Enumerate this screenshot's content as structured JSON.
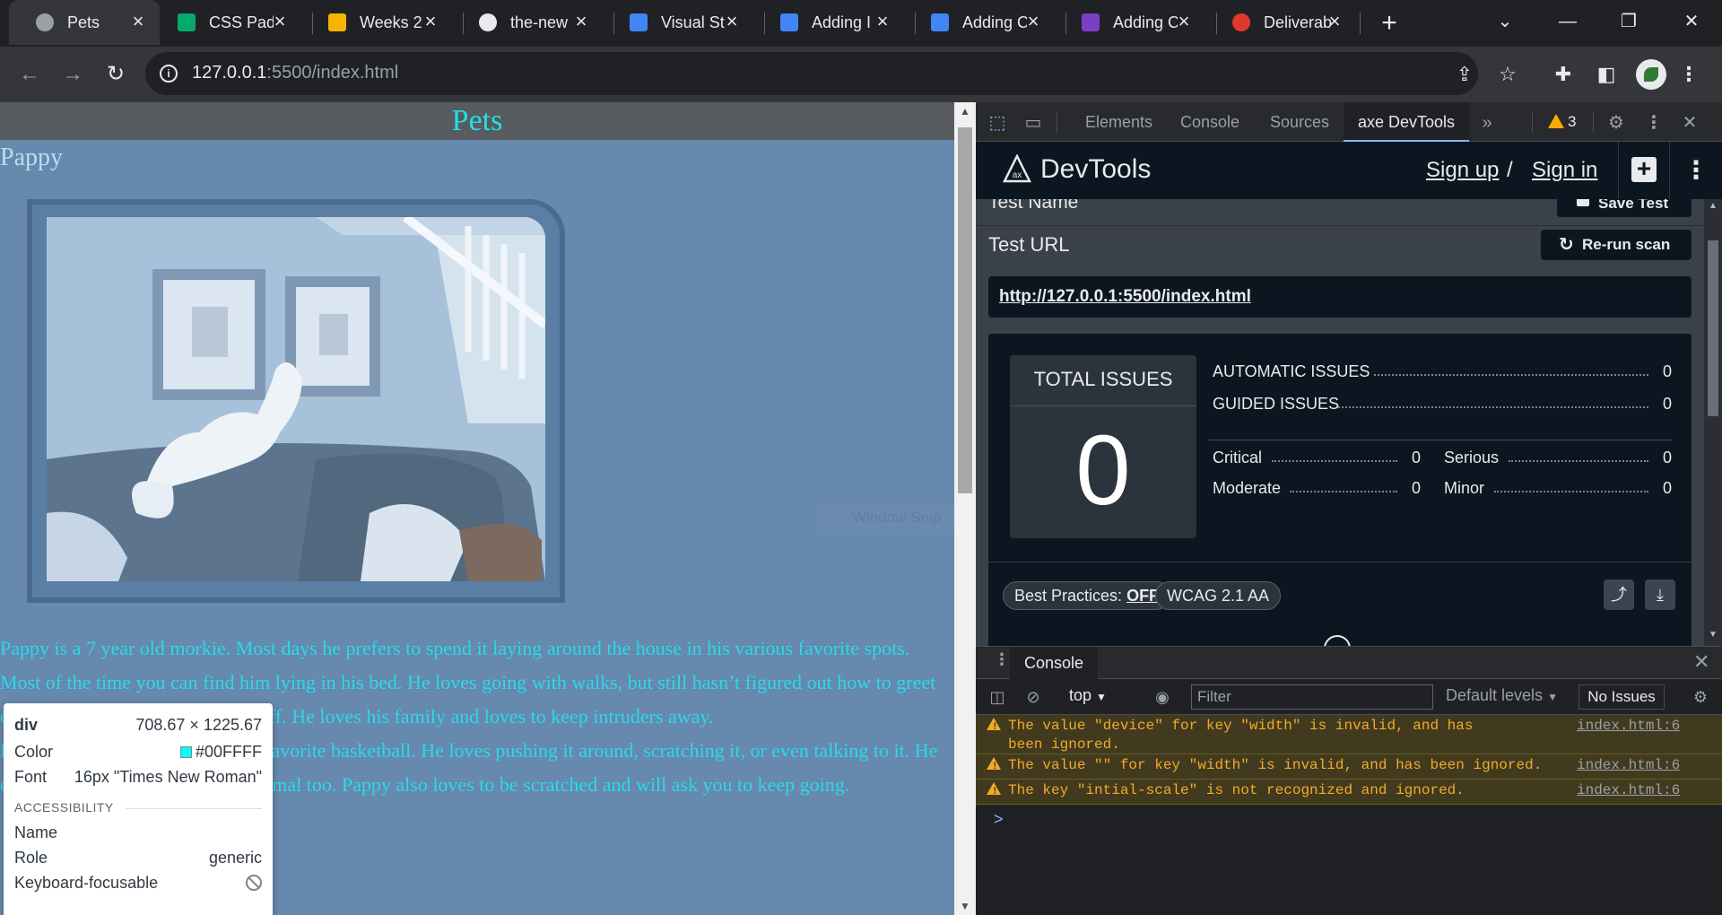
{
  "browser": {
    "tabs": [
      {
        "title": "Pets",
        "active": true
      },
      {
        "title": "CSS Padd",
        "active": false
      },
      {
        "title": "Weeks 2",
        "active": false
      },
      {
        "title": "the-new",
        "active": false
      },
      {
        "title": "Visual St",
        "active": false
      },
      {
        "title": "Adding I",
        "active": false
      },
      {
        "title": "Adding C",
        "active": false
      },
      {
        "title": "Adding C",
        "active": false
      },
      {
        "title": "Deliverab",
        "active": false
      }
    ],
    "url_host": "127.0.0.1",
    "url_rest": ":5500/index.html"
  },
  "page": {
    "site_title": "Pets",
    "pet_name": "Pappy",
    "bio_paragraph_1": "Pappy is a 7 year old morkie. Most days he prefers to spend it laying around the house in his various favorite spots. Most of the time you can find him lying in his bed. He loves going with walks, but still hasn’t figured out how to greet other dogs without scaring them off. He loves his family and loves to keep intruders away.",
    "bio_paragraph_2": "Pappy also loves to play with his favorite basketball. He loves pushing it around, scratching it, or even talking to it. He enjoys playing with his stuffed animal too. Pappy also loves to be scratched and will ask you to keep going.",
    "title_color": "#00FFFF",
    "body_bg": "#6689ad"
  },
  "inspector": {
    "tag": "div",
    "dimensions": "708.67 × 1225.67",
    "color_label": "Color",
    "color_value": "#00FFFF",
    "font_label": "Font",
    "font_value": "16px \"Times New Roman\"",
    "accessibility_header": "ACCESSIBILITY",
    "name_label": "Name",
    "role_label": "Role",
    "role_value": "generic",
    "keyboard_label": "Keyboard-focusable"
  },
  "snip_overlay": "Window Snip",
  "devtools": {
    "tabs": [
      "Elements",
      "Console",
      "Sources",
      "axe DevTools"
    ],
    "active_tab": "axe DevTools",
    "warning_count": "3"
  },
  "axe": {
    "title": "DevTools",
    "sign_up": "Sign up",
    "separator": "/",
    "sign_in": "Sign in",
    "test_name_label": "Test Name",
    "save_test": "Save Test",
    "test_url_label": "Test URL",
    "rerun": "Re-run scan",
    "test_url": "http://127.0.0.1:5500/index.html",
    "total_label": "TOTAL ISSUES",
    "total_value": "0",
    "automatic_label": "AUTOMATIC ISSUES",
    "automatic_value": "0",
    "guided_label": "GUIDED ISSUES",
    "guided_value": "0",
    "critical_label": "Critical",
    "critical_value": "0",
    "serious_label": "Serious",
    "serious_value": "0",
    "moderate_label": "Moderate",
    "moderate_value": "0",
    "minor_label": "Minor",
    "minor_value": "0",
    "best_practices_label": "Best Practices:",
    "best_practices_value": "OFF",
    "wcag": "WCAG 2.1 AA"
  },
  "console": {
    "tab": "Console",
    "context": "top",
    "filter_placeholder": "Filter",
    "levels": "Default levels",
    "issues": "No Issues",
    "messages": [
      {
        "text": "The value \"device\" for key \"width\" is invalid, and has been ignored.",
        "source": "index.html:6"
      },
      {
        "text": "The value \"\" for key \"width\" is invalid, and has been ignored.",
        "source": "index.html:6"
      },
      {
        "text": "The key \"intial-scale\" is not recognized and ignored.",
        "source": "index.html:6"
      }
    ],
    "prompt": ">"
  }
}
